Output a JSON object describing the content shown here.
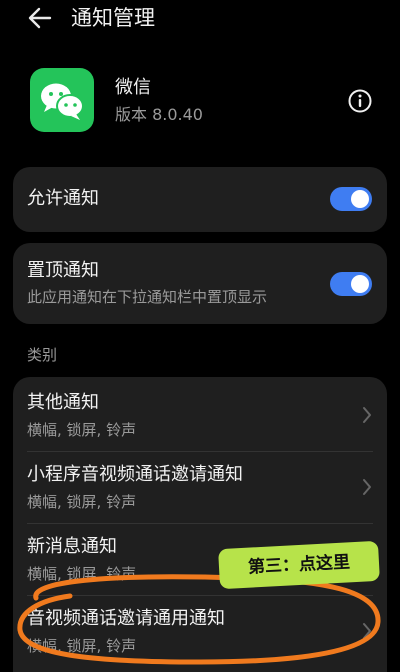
{
  "header": {
    "title": "通知管理"
  },
  "app": {
    "name": "微信",
    "version": "版本 8.0.40"
  },
  "allow_notifications": {
    "label": "允许通知",
    "enabled": true
  },
  "pin_notifications": {
    "label": "置顶通知",
    "description": "此应用通知在下拉通知栏中置顶显示",
    "enabled": true
  },
  "categories": {
    "section_label": "类别",
    "items": [
      {
        "title": "其他通知",
        "subtitle": "横幅, 锁屏, 铃声"
      },
      {
        "title": "小程序音视频通话邀请通知",
        "subtitle": "横幅, 锁屏, 铃声"
      },
      {
        "title": "新消息通知",
        "subtitle": "横幅, 锁屏, 铃声"
      },
      {
        "title": "音视频通话邀请通用通知",
        "subtitle": "横幅, 锁屏, 铃声"
      }
    ]
  },
  "annotation": {
    "label": "第三：点这里"
  },
  "colors": {
    "toggle_on": "#3f7df2",
    "app_icon": "#24c45a",
    "annotation_ring": "#f07a1e",
    "annotation_label_bg": "#b7e34a"
  },
  "icons": {
    "back": "arrow-left-icon",
    "info": "info-icon",
    "chevron": "chevron-right-icon",
    "app": "wechat-icon"
  }
}
